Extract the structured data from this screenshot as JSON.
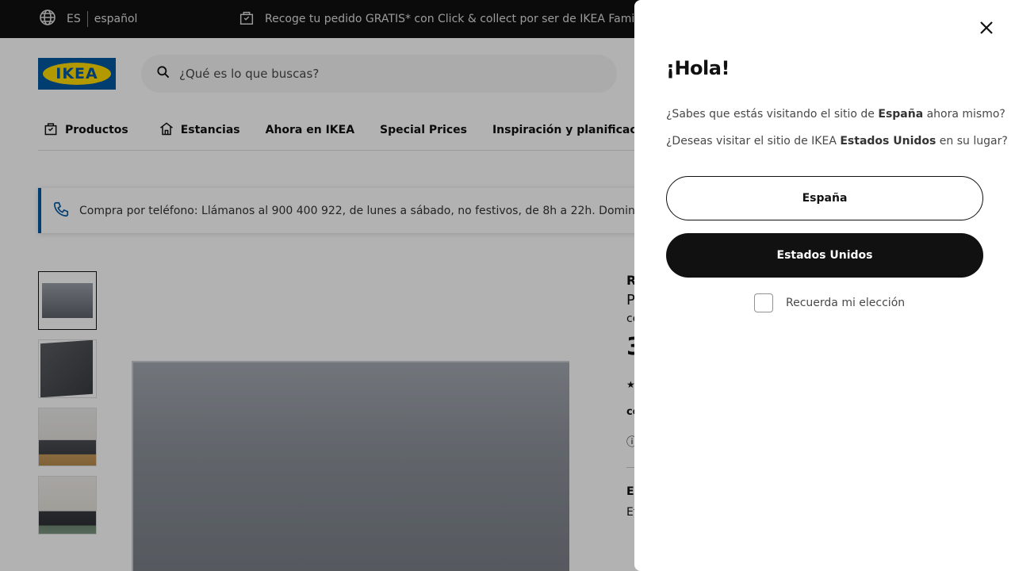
{
  "topbar": {
    "language_code": "ES",
    "language_name": "español",
    "promo_text": "Recoge tu pedido GRATIS* con Click & collect por ser de IKEA Family"
  },
  "header": {
    "logo_text": "IKEA",
    "search_placeholder": "¿Qué es lo que buscas?"
  },
  "nav": {
    "items": [
      {
        "label": "Productos",
        "icon": "shopping-bag-icon"
      },
      {
        "label": "Estancias",
        "icon": "home-icon"
      },
      {
        "label": "Ahora en IKEA"
      },
      {
        "label": "Special Prices"
      },
      {
        "label": "Inspiración y planificación"
      }
    ]
  },
  "banner": {
    "text": "Compra por teléfono: Llámanos al 900 400 922, de lunes a sábado, no festivos, de 8h a 22h. Domingos y f"
  },
  "product_peek": {
    "line1": "R",
    "line2": "P",
    "line3": "ce",
    "line4": "3",
    "line5": "co",
    "line6": "El",
    "line7": "Et"
  },
  "modal": {
    "title": "¡Hola!",
    "line1_before": "¿Sabes que estás visitando el sitio de ",
    "line1_bold": "España",
    "line1_after": " ahora mismo?",
    "line2_before": "¿Deseas visitar el sitio de IKEA ",
    "line2_bold": "Estados Unidos",
    "line2_after": " en su lugar?",
    "button_primary_outline": "España",
    "button_primary_filled": "Estados Unidos",
    "remember_label": "Recuerda mi elección"
  },
  "colors": {
    "topbar_bg": "#111111",
    "ikea_blue": "#0058a3",
    "ikea_yellow": "#ffdb00",
    "overlay": "rgba(0,0,0,0.3)"
  }
}
